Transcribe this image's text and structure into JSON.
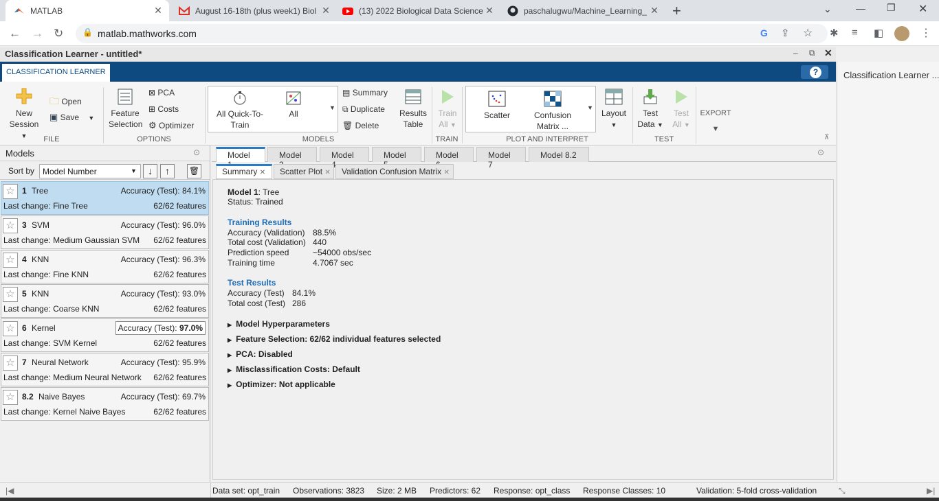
{
  "browser": {
    "tabs": [
      {
        "title": "MATLAB",
        "icon": "matlab-icon"
      },
      {
        "title": "August 16-18th (plus week1) Biol",
        "icon": "gmail-icon"
      },
      {
        "title": "(13) 2022 Biological Data Science",
        "icon": "youtube-icon"
      },
      {
        "title": "paschalugwu/Machine_Learning_",
        "icon": "github-icon"
      }
    ],
    "url": "matlab.mathworks.com"
  },
  "app": {
    "title": "Classification Learner - untitled*",
    "strip_tab": "CLASSIFICATION LEARNER",
    "help": "?"
  },
  "ribbon": {
    "file": {
      "label": "FILE",
      "new_session": "New",
      "new_session2": "Session",
      "open": "Open",
      "save": "Save"
    },
    "options": {
      "label": "OPTIONS",
      "feature_selection": "Feature",
      "feature_selection2": "Selection",
      "pca": "PCA",
      "costs": "Costs",
      "optimizer": "Optimizer"
    },
    "models": {
      "label": "MODELS",
      "quick": "All Quick-To-",
      "quick2": "Train",
      "all": "All",
      "summary": "Summary",
      "duplicate": "Duplicate",
      "delete": "Delete",
      "results_table": "Results",
      "results_table2": "Table"
    },
    "train": {
      "label": "TRAIN",
      "train_all": "Train",
      "train_all2": "All"
    },
    "plot": {
      "label": "PLOT AND INTERPRET",
      "scatter": "Scatter",
      "confusion": "Confusion",
      "confusion2": "Matrix",
      "ellipsis": "...",
      "layout": "Layout"
    },
    "test": {
      "label": "TEST",
      "test_data": "Test",
      "test_data2": "Data",
      "test_all": "Test",
      "test_all2": "All"
    },
    "export": {
      "label": "EXPORT"
    }
  },
  "right_pane": {
    "title": "Classification Learner ..."
  },
  "models_panel": {
    "title": "Models",
    "sort_label": "Sort by",
    "sort_value": "Model Number",
    "items": [
      {
        "num": "1",
        "type": "Tree",
        "acc_label": "Accuracy (Test):",
        "acc": "84.1%",
        "last": "Last change:",
        "change": "Fine Tree",
        "features": "62/62 features"
      },
      {
        "num": "3",
        "type": "SVM",
        "acc_label": "Accuracy (Test):",
        "acc": "96.0%",
        "last": "Last change:",
        "change": "Medium Gaussian SVM",
        "features": "62/62 features"
      },
      {
        "num": "4",
        "type": "KNN",
        "acc_label": "Accuracy (Test):",
        "acc": "96.3%",
        "last": "Last change:",
        "change": "Fine KNN",
        "features": "62/62 features"
      },
      {
        "num": "5",
        "type": "KNN",
        "acc_label": "Accuracy (Test):",
        "acc": "93.0%",
        "last": "Last change:",
        "change": "Coarse KNN",
        "features": "62/62 features"
      },
      {
        "num": "6",
        "type": "Kernel",
        "acc_label": "Accuracy (Test):",
        "acc": "97.0%",
        "last": "Last change:",
        "change": "SVM Kernel",
        "features": "62/62 features"
      },
      {
        "num": "7",
        "type": "Neural Network",
        "acc_label": "Accuracy (Test):",
        "acc": "95.9%",
        "last": "Last change:",
        "change": "Medium Neural Network",
        "features": "62/62 features"
      },
      {
        "num": "8.2",
        "type": "Naive Bayes",
        "acc_label": "Accuracy (Test):",
        "acc": "69.7%",
        "last": "Last change:",
        "change": "Kernel Naive Bayes",
        "features": "62/62 features"
      }
    ]
  },
  "doc_tabs": [
    "Model 1",
    "Model 3",
    "Model 4",
    "Model 5",
    "Model 6",
    "Model 7",
    "Model 8.2"
  ],
  "sub_tabs": [
    "Summary",
    "Scatter Plot",
    "Validation Confusion Matrix"
  ],
  "summary": {
    "model_label": "Model 1",
    "model_type": ": Tree",
    "status": "Status: Trained",
    "training_header": "Training Results",
    "training": [
      {
        "k": "Accuracy (Validation)",
        "v": "88.5%"
      },
      {
        "k": "Total cost (Validation)",
        "v": "440"
      },
      {
        "k": "Prediction speed",
        "v": "~54000 obs/sec"
      },
      {
        "k": "Training time",
        "v": "4.7067 sec"
      }
    ],
    "test_header": "Test Results",
    "test": [
      {
        "k": "Accuracy (Test)",
        "v": "84.1%"
      },
      {
        "k": "Total cost (Test)",
        "v": "286"
      }
    ],
    "sections": [
      "Model Hyperparameters",
      "Feature Selection: 62/62 individual features selected",
      "PCA: Disabled",
      "Misclassification Costs: Default",
      "Optimizer: Not applicable"
    ]
  },
  "status": {
    "dataset": "Data set: opt_train",
    "observations": "Observations: 3823",
    "size": "Size: 2 MB",
    "predictors": "Predictors: 62",
    "response": "Response: opt_class",
    "classes": "Response Classes: 10",
    "validation": "Validation: 5-fold cross-validation"
  },
  "colors": {
    "accent": "#0e4a80",
    "selected": "#bfdcf0",
    "header_blue": "#1f6cb5"
  }
}
